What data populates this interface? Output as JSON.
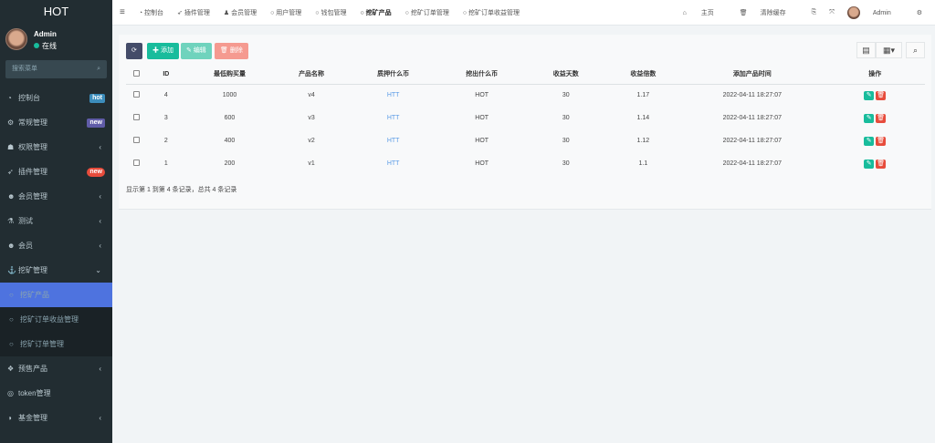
{
  "app": {
    "title": "HOT"
  },
  "user": {
    "name": "Admin",
    "status": "在线"
  },
  "sidebar": {
    "search_placeholder": "搜索菜单",
    "items": [
      {
        "label": "控制台",
        "icon": "dashboard-icon",
        "badge": "hot",
        "badge_color": "#3c8dbc"
      },
      {
        "label": "常规管理",
        "icon": "cogs-icon",
        "badge": "new",
        "badge_color": "#605ca8"
      },
      {
        "label": "权限管理",
        "icon": "group-icon",
        "arrow": "‹"
      },
      {
        "label": "插件管理",
        "icon": "rocket-icon",
        "badge": "new",
        "badge_color": "#e74c3c"
      },
      {
        "label": "会员管理",
        "icon": "user-circle-icon",
        "arrow": "‹"
      },
      {
        "label": "测试",
        "icon": "flask-icon",
        "arrow": "‹"
      },
      {
        "label": "会员",
        "icon": "user-circle-icon",
        "arrow": "‹"
      },
      {
        "label": "挖矿管理",
        "icon": "anchor-icon",
        "arrow": "⌄"
      }
    ],
    "sub_items": [
      {
        "label": "挖矿产品"
      },
      {
        "label": "挖矿订单收益管理"
      },
      {
        "label": "挖矿订单管理"
      }
    ],
    "items2": [
      {
        "label": "预售产品",
        "icon": "cubes-icon",
        "arrow": "‹"
      },
      {
        "label": "token管理",
        "icon": "token-icon"
      },
      {
        "label": "基金管理",
        "icon": "adjust-icon",
        "arrow": "‹"
      }
    ]
  },
  "topnav": {
    "tabs": [
      "控制台",
      "插件管理",
      "会员管理",
      "用户管理",
      "钱包管理",
      "挖矿产品",
      "挖矿订单管理",
      "挖矿订单收益管理"
    ],
    "right": {
      "home": "主页",
      "clear_cache": "清除缓存",
      "user": "Admin"
    }
  },
  "toolbar": {
    "add": "添加",
    "edit": "编辑",
    "delete": "删除"
  },
  "table": {
    "headers": [
      "ID",
      "最低购买量",
      "产品名称",
      "质押什么币",
      "挖出什么币",
      "收益天数",
      "收益倍数",
      "添加产品时间",
      "操作"
    ],
    "rows": [
      [
        "4",
        "1000",
        "v4",
        "HTT",
        "HOT",
        "30",
        "1.17",
        "2022-04-11 18:27:07"
      ],
      [
        "3",
        "600",
        "v3",
        "HTT",
        "HOT",
        "30",
        "1.14",
        "2022-04-11 18:27:07"
      ],
      [
        "2",
        "400",
        "v2",
        "HTT",
        "HOT",
        "30",
        "1.12",
        "2022-04-11 18:27:07"
      ],
      [
        "1",
        "200",
        "v1",
        "HTT",
        "HOT",
        "30",
        "1.1",
        "2022-04-11 18:27:07"
      ]
    ]
  },
  "pagination": {
    "summary": "显示第 1 到第 4 条记录，总共 4 条记录"
  }
}
